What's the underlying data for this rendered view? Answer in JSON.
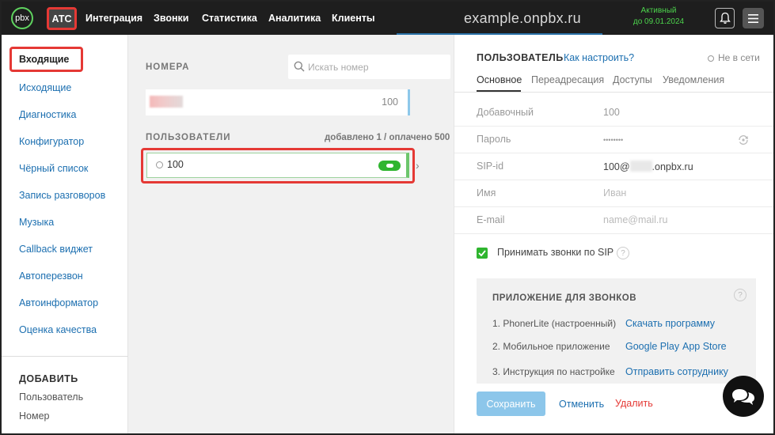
{
  "colors": {
    "accent_link": "#1c6fb0",
    "highlight": "#e53935",
    "online_green": "#2fb52f",
    "topbar_bg": "#1e1e1e"
  },
  "topbar": {
    "logo_text": "pbx",
    "nav": [
      "АТС",
      "Интеграция",
      "Звонки",
      "Статистика",
      "Аналитика",
      "Клиенты"
    ],
    "domain": "example.onpbx.ru",
    "status_line1": "Активный",
    "status_line2": "до 09.01.2024",
    "icons": [
      "bell-icon",
      "menu-icon"
    ]
  },
  "sidebar": {
    "items": [
      "Входящие",
      "Исходящие",
      "Диагностика",
      "Конфигуратор",
      "Чёрный список",
      "Запись разговоров",
      "Музыка",
      "Callback виджет",
      "Автоперезвон",
      "Автоинформатор",
      "Оценка качества"
    ],
    "add_title": "ДОБАВИТЬ",
    "add_items": [
      "Пользователь",
      "Номер"
    ]
  },
  "numbers": {
    "title": "НОМЕРА",
    "search_placeholder": "Искать номер",
    "number_ext": "100"
  },
  "users": {
    "title": "ПОЛЬЗОВАТЕЛИ",
    "counter": "добавлено 1 / оплачено 500",
    "user_label": "100"
  },
  "panel": {
    "title": "ПОЛЬЗОВАТЕЛЬ",
    "howto": "Как настроить?",
    "online_status": "Не в сети",
    "tabs": [
      "Основное",
      "Переадресация",
      "Доступы",
      "Уведомления"
    ],
    "fields": {
      "ext_label": "Добавочный",
      "ext_value": "100",
      "password_label": "Пароль",
      "password_value": "••••••••",
      "sip_label": "SIP-id",
      "sip_prefix": "100@",
      "sip_suffix": ".onpbx.ru",
      "name_label": "Имя",
      "name_placeholder": "Иван",
      "email_label": "E-mail",
      "email_placeholder": "name@mail.ru"
    },
    "accept_sip_label": "Принимать звонки по SIP",
    "help_glyph": "?",
    "app_box": {
      "title": "ПРИЛОЖЕНИЕ ДЛЯ ЗВОНКОВ",
      "row1": "1. PhonerLite (настроенный)",
      "row1_link": "Скачать программу",
      "row2": "2. Мобильное приложение",
      "row2_link_a": "Google Play",
      "row2_link_b": "App Store",
      "row3": "3. Инструкция по настройке",
      "row3_link": "Отправить сотруднику"
    },
    "buttons": {
      "save": "Сохранить",
      "cancel": "Отменить",
      "delete": "Удалить"
    }
  }
}
